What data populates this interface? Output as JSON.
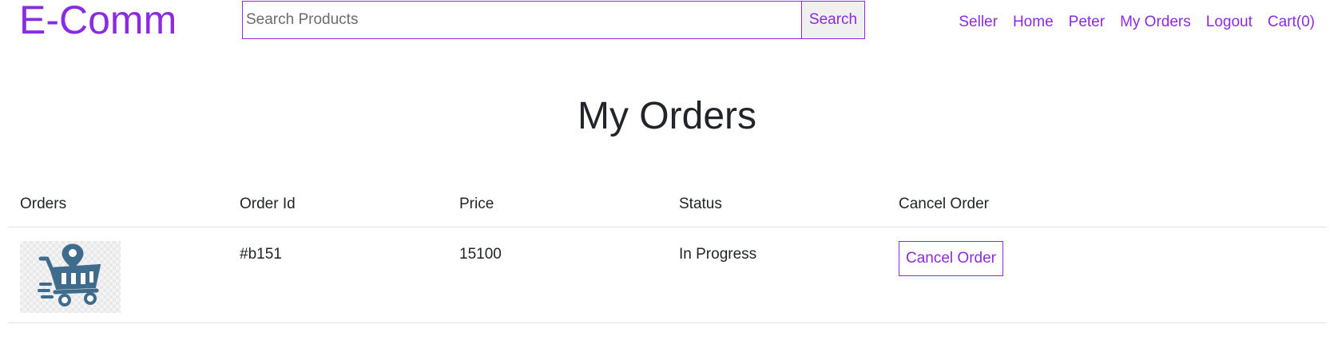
{
  "brand": {
    "name": "E-Comm",
    "accent_color": "#8a2be2"
  },
  "search": {
    "placeholder": "Search Products",
    "value": "",
    "button_label": "Search"
  },
  "nav": {
    "links": [
      {
        "label": "Seller"
      },
      {
        "label": "Home"
      },
      {
        "label": "Peter"
      },
      {
        "label": "My Orders"
      },
      {
        "label": "Logout"
      },
      {
        "label": "Cart(0)"
      }
    ]
  },
  "page": {
    "title": "My Orders"
  },
  "orders_table": {
    "headers": [
      "Orders",
      "Order Id",
      "Price",
      "Status",
      "Cancel Order"
    ],
    "rows": [
      {
        "image_icon": "shopping-cart-location-icon",
        "order_id": "#b151",
        "price": "15100",
        "status": "In Progress",
        "cancel_label": "Cancel Order"
      }
    ]
  }
}
